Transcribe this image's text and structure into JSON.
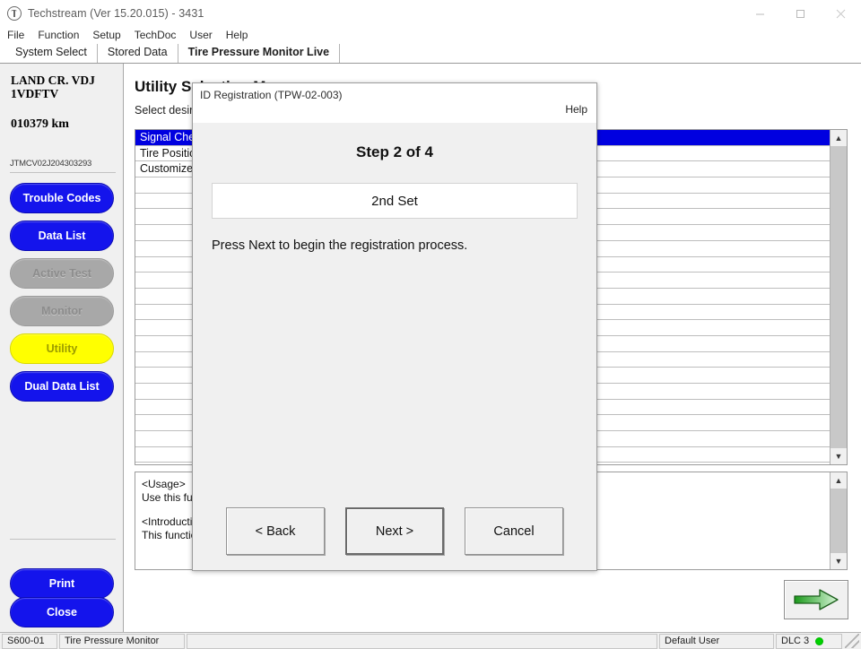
{
  "window": {
    "title": "Techstream (Ver 15.20.015) - 3431",
    "app_icon": "techstream-logo-icon",
    "controls": {
      "minimize": "minimize-icon",
      "maximize": "maximize-icon",
      "close": "close-icon"
    }
  },
  "menubar": {
    "items": [
      "File",
      "Function",
      "Setup",
      "TechDoc",
      "User",
      "Help"
    ]
  },
  "tabs": [
    {
      "label": "System Select",
      "active": false
    },
    {
      "label": "Stored Data",
      "active": false
    },
    {
      "label": "Tire Pressure Monitor Live",
      "active": true
    }
  ],
  "sidebar": {
    "vehicle_model": "LAND CR. VDJ 1VDFTV",
    "odometer": "010379 km",
    "vin": "JTMCV02J204303293",
    "buttons": [
      {
        "label": "Trouble Codes",
        "state": "enabled"
      },
      {
        "label": "Data List",
        "state": "enabled"
      },
      {
        "label": "Active Test",
        "state": "disabled"
      },
      {
        "label": "Monitor",
        "state": "disabled"
      },
      {
        "label": "Utility",
        "state": "selected"
      },
      {
        "label": "Dual Data List",
        "state": "enabled"
      }
    ],
    "print_label": "Print",
    "close_label": "Close"
  },
  "main": {
    "title": "Utility Selection Menu",
    "subtitle": "Select desired utility and press Next.",
    "list": {
      "rows": [
        {
          "text": "Signal Check",
          "selected": true
        },
        {
          "text": "Tire Position Write",
          "selected": false
        },
        {
          "text": "Customize",
          "selected": false
        }
      ],
      "empty_row_count": 18,
      "scrollbar": {
        "up_arrow": "chevron-up-icon",
        "down_arrow": "chevron-down-icon"
      }
    },
    "usage": {
      "heading1": "<Usage>",
      "line1": "Use this function to check the signal of the tire pressure transmitter.",
      "heading2": "<Introduction>",
      "line2": "This function is used to register the transmitter ID."
    },
    "next_arrow": "green-right-arrow-icon"
  },
  "dialog": {
    "title": "ID Registration (TPW-02-003)",
    "help_label": "Help",
    "step_label": "Step 2 of 4",
    "set_value": "2nd Set",
    "instruction": "Press Next to begin the registration process.",
    "buttons": [
      {
        "label": "< Back",
        "default": false
      },
      {
        "label": "Next >",
        "default": true
      },
      {
        "label": "Cancel",
        "default": false
      }
    ]
  },
  "statusbar": {
    "code": "S600-01",
    "system": "Tire Pressure Monitor",
    "message": "",
    "user": "Default User",
    "connection": "DLC 3",
    "status_color": "#00d200"
  }
}
